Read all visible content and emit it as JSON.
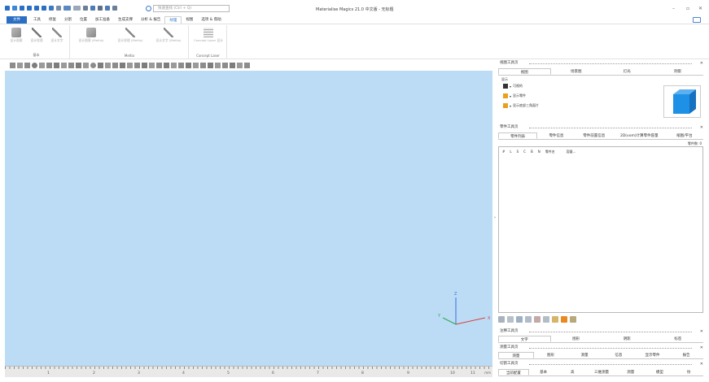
{
  "app": {
    "title": "Materialise Magics 21.0 中文版 - 无标题",
    "search_placeholder": "快速查找 (Ctrl + Q)"
  },
  "menu_tabs": [
    "文件",
    "工具",
    "修复",
    "分割",
    "位置",
    "加工准备",
    "生成支撑",
    "分析 & 报告",
    "纹理",
    "视图",
    "选项 & 帮助"
  ],
  "active_tab": "纹理",
  "ribbon": {
    "groups": [
      {
        "label": "基本",
        "buttons": [
          "设计图案",
          "设计纹理",
          "设计文字"
        ]
      },
      {
        "label": "Meltio",
        "buttons": [
          "设计图案 (Meltio)",
          "设计纹理 (Meltio)",
          "设计文字 (Meltio)"
        ]
      },
      {
        "label": "Concept Laser",
        "buttons": [
          "Concept Laser 设计"
        ]
      }
    ]
  },
  "ruler": {
    "labels": [
      "1",
      "2",
      "3",
      "4",
      "5",
      "6",
      "7",
      "8",
      "9",
      "10",
      "11"
    ],
    "unit": "mm"
  },
  "axes": {
    "x": "X",
    "y": "Y",
    "z": "Z"
  },
  "view_panel": {
    "title": "视图工具页",
    "tabs": [
      "视图",
      "场景图",
      "灯光",
      "阴影"
    ],
    "section_label": "显示",
    "rows": [
      "可视的",
      "显示零件",
      "显示底部三角面片"
    ]
  },
  "part_panel": {
    "title": "零件工具页",
    "tabs": [
      "零件列表",
      "零件信息",
      "零件前置信息",
      "2D(vom)计算零件容量",
      "缩图/平台"
    ],
    "count_label": "零件数: 0",
    "columns": [
      "#",
      "L",
      "S",
      "C",
      "B",
      "N",
      "零件名",
      "容量..."
    ]
  },
  "collapsed_panels": [
    {
      "title": "注释工具页",
      "tabs": [
        "文字",
        "图形",
        "阴影",
        "标签"
      ]
    },
    {
      "title": "测量工具页",
      "tabs": [
        "测量",
        "图形",
        "测量",
        "信息",
        "显示零件",
        "报告"
      ]
    },
    {
      "title": "切割工具页",
      "tabs": [
        "当前配置",
        "基本",
        "高",
        "三维测量",
        "测量",
        "模型",
        "纹"
      ]
    }
  ],
  "colors": {
    "accent": "#2b6fc4",
    "viewport": "#bcdcf6",
    "cube": "#1e90e6"
  }
}
